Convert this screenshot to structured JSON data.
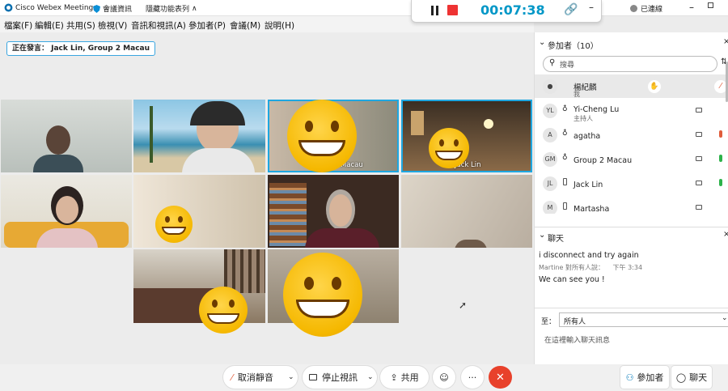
{
  "app": {
    "name": "Cisco Webex Meetings",
    "meeting_info": "會議資訊",
    "hide_menu": "隱藏功能表列",
    "connection_status": "已連線"
  },
  "menu": [
    "檔案(F)",
    "編輯(E)",
    "共用(S)",
    "檢視(V)",
    "音訊和視訊(A)",
    "參加者(P)",
    "會議(M)",
    "說明(H)"
  ],
  "recorder": {
    "elapsed": "00:07:38"
  },
  "active_speaker": "正在發言： Jack Lin, Group 2 Macau",
  "tiles": [
    {
      "name": ""
    },
    {
      "name": ""
    },
    {
      "name": "Macau"
    },
    {
      "name": "Jack Lin"
    }
  ],
  "participants": {
    "header": "參加者（10）",
    "search_placeholder": "搜尋",
    "list": [
      {
        "name": "楊紀麟",
        "role": "我",
        "initials": ""
      },
      {
        "name": "Yi-Cheng Lu",
        "role": "主持人",
        "initials": "YL"
      },
      {
        "name": "agatha",
        "role": "",
        "initials": "A"
      },
      {
        "name": "Group 2 Macau",
        "role": "",
        "initials": "GM"
      },
      {
        "name": "Jack Lin",
        "role": "",
        "initials": "JL"
      },
      {
        "name": "Martasha",
        "role": "",
        "initials": "M"
      }
    ]
  },
  "chat": {
    "header": "聊天",
    "messages": [
      {
        "text": "i disconnect and try again"
      },
      {
        "meta": "Martine 對所有人說：",
        "time": "下午 3:34"
      },
      {
        "text": "We can see you !"
      }
    ],
    "to_label": "至：",
    "recipient": "所有人",
    "input_placeholder": "在這裡輸入聊天訊息"
  },
  "controls": {
    "unmute": "取消靜音",
    "stop_video": "停止視訊",
    "share": "共用",
    "more": "···",
    "participants_tab": "參加者",
    "chat_tab": "聊天"
  },
  "colors": {
    "accent": "#00a0d1",
    "end_red": "#e8412b",
    "mic_green": "#2db24a",
    "mic_muted": "#e05c3b"
  }
}
